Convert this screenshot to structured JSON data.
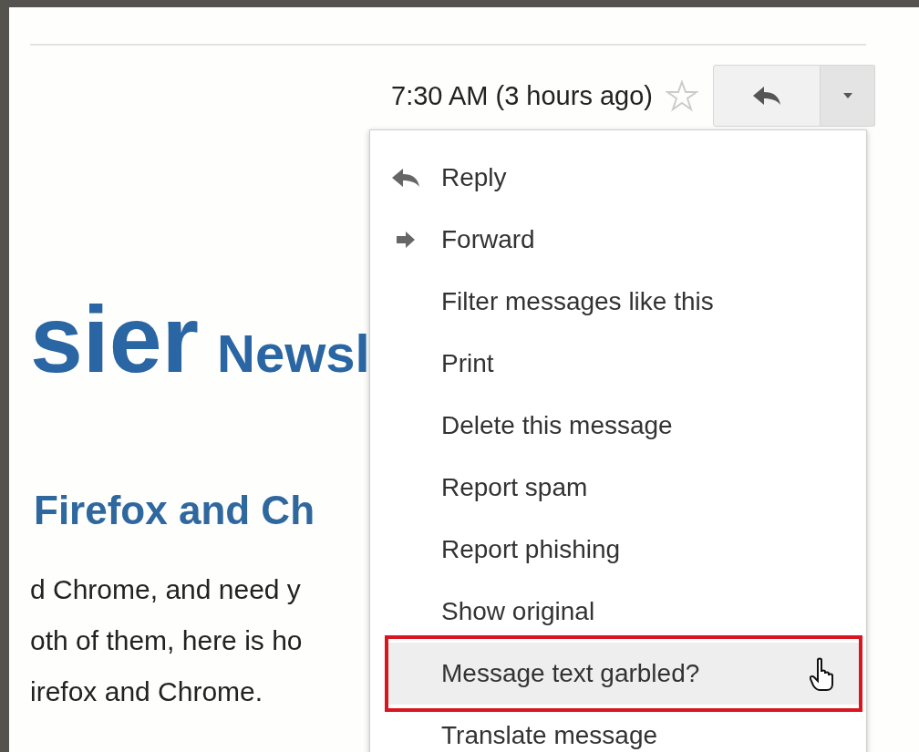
{
  "message_header": {
    "timestamp": "7:30 AM (3 hours ago)",
    "starred": false
  },
  "body": {
    "logo_text": "sier",
    "logo_suffix": "Newsl",
    "heading": "Firefox and Ch",
    "lines": [
      "d Chrome, and need y",
      "oth of them, here is ho",
      "irefox and Chrome."
    ]
  },
  "menu": {
    "items": [
      {
        "label": "Reply",
        "kind": "reply",
        "highlighted": false,
        "outlined": false
      },
      {
        "label": "Forward",
        "kind": "forward",
        "highlighted": false,
        "outlined": false
      },
      {
        "label": "Filter messages like this",
        "kind": "plain",
        "highlighted": false,
        "outlined": false
      },
      {
        "label": "Print",
        "kind": "plain",
        "highlighted": false,
        "outlined": false
      },
      {
        "label": "Delete this message",
        "kind": "plain",
        "highlighted": false,
        "outlined": false
      },
      {
        "label": "Report spam",
        "kind": "plain",
        "highlighted": false,
        "outlined": false
      },
      {
        "label": "Report phishing",
        "kind": "plain",
        "highlighted": false,
        "outlined": false
      },
      {
        "label": "Show original",
        "kind": "plain",
        "highlighted": false,
        "outlined": false
      },
      {
        "label": "Message text garbled?",
        "kind": "plain",
        "highlighted": true,
        "outlined": true
      },
      {
        "label": "Translate message",
        "kind": "plain",
        "highlighted": false,
        "outlined": false
      }
    ]
  }
}
